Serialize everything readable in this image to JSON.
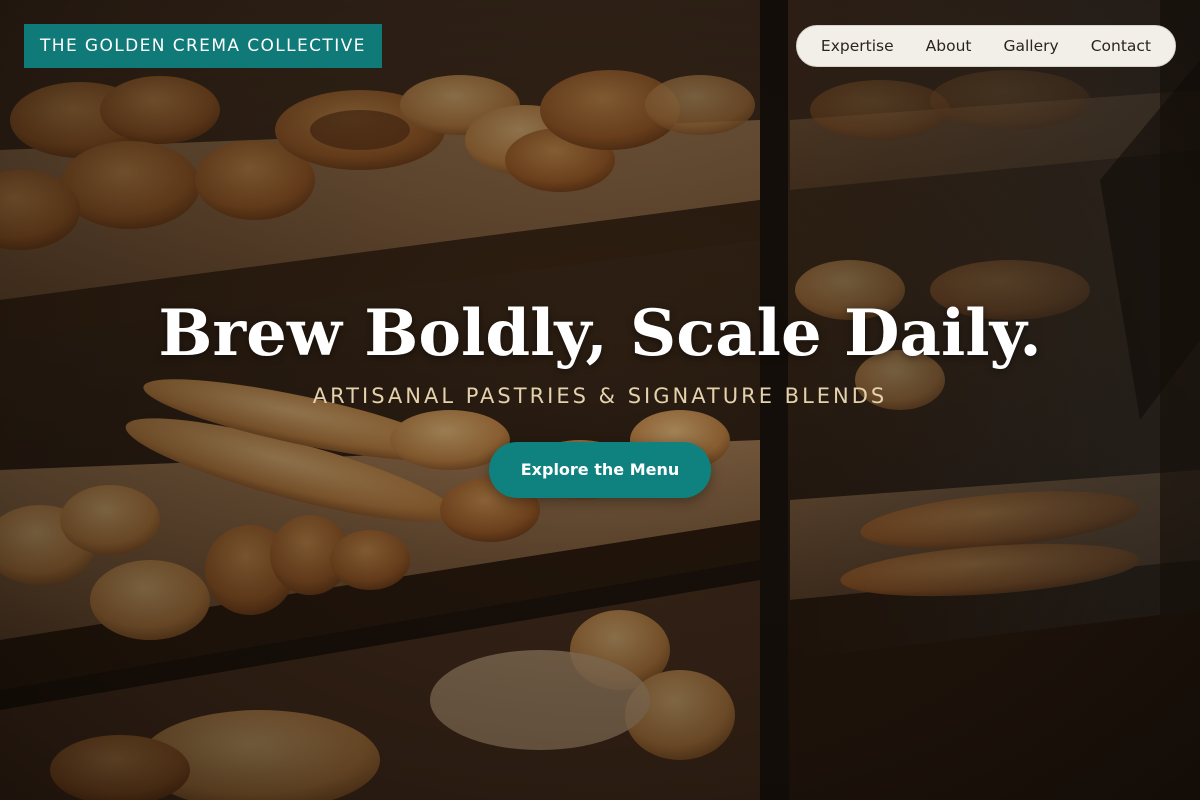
{
  "header": {
    "brand": "THE GOLDEN CREMA COLLECTIVE"
  },
  "nav": {
    "items": [
      {
        "label": "Expertise"
      },
      {
        "label": "About"
      },
      {
        "label": "Gallery"
      },
      {
        "label": "Contact"
      }
    ]
  },
  "hero": {
    "headline": "Brew Boldly, Scale Daily.",
    "tagline": "ARTISANAL PASTRIES & SIGNATURE BLENDS",
    "cta_label": "Explore the Menu",
    "background_image": "bakery display case with breads and pastries"
  },
  "colors": {
    "accent": "#0f7a78",
    "tagline": "#e3d2ac",
    "nav_background": "#f2eee8"
  }
}
